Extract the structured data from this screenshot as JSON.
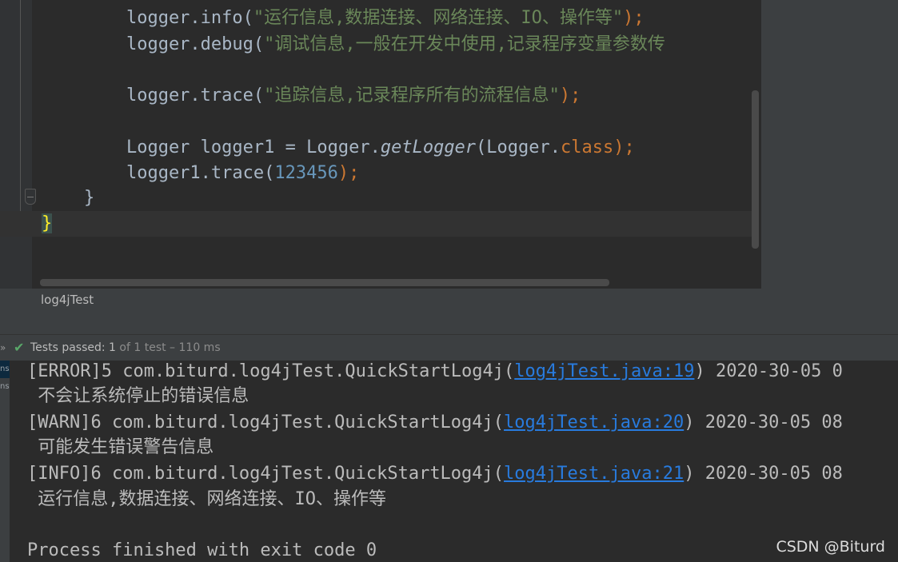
{
  "editor": {
    "lines": [
      {
        "p1": "        logger.info(",
        "s": "\"运行信息,数据连接、网络连接、IO、操作等\"",
        "p2": ");"
      },
      {
        "p1": "        logger.debug(",
        "s": "\"调试信息,一般在开发中使用,记录程序变量参数传",
        "p2": ""
      },
      {
        "p1": "        logger.trace(",
        "s": "\"追踪信息,记录程序所有的流程信息\"",
        "p2": ");"
      },
      {
        "a": "        Logger logger1 = Logger.",
        "m": "getLogger",
        "b": "(Logger.",
        "k": "class",
        "c": ");"
      },
      {
        "a": "        logger1.trace(",
        "n": "123456",
        "c": ");"
      },
      {
        "a": "    }"
      },
      {
        "brace": "}"
      }
    ]
  },
  "file": {
    "breadcrumb": "log4jTest"
  },
  "tests": {
    "label": "Tests passed:",
    "count": "1",
    "summary": "of 1 test – 110 ms"
  },
  "left_strip": {
    "labels": [
      "ns",
      "ns"
    ]
  },
  "console": {
    "lines": [
      {
        "pre": "[ERROR]5 com.biturd.log4jTest.QuickStartLog4j(",
        "link": "log4jTest.java:19",
        "post": ") 2020-30-05 0"
      },
      {
        "pre": " 不会让系统停止的错误信息"
      },
      {
        "pre": "[WARN]6 com.biturd.log4jTest.QuickStartLog4j(",
        "link": "log4jTest.java:20",
        "post": ") 2020-30-05 08"
      },
      {
        "pre": " 可能发生错误警告信息"
      },
      {
        "pre": "[INFO]6 com.biturd.log4jTest.QuickStartLog4j(",
        "link": "log4jTest.java:21",
        "post": ") 2020-30-05 08"
      },
      {
        "pre": " 运行信息,数据连接、网络连接、IO、操作等"
      },
      {
        "pre": ""
      },
      {
        "pre": "Process finished with exit code 0"
      }
    ]
  },
  "watermark": "CSDN @Biturd",
  "colors": {
    "string": "#6a8759",
    "keyword": "#cc7832",
    "number": "#6897bb",
    "link": "#287bde",
    "pass": "#59a869"
  }
}
